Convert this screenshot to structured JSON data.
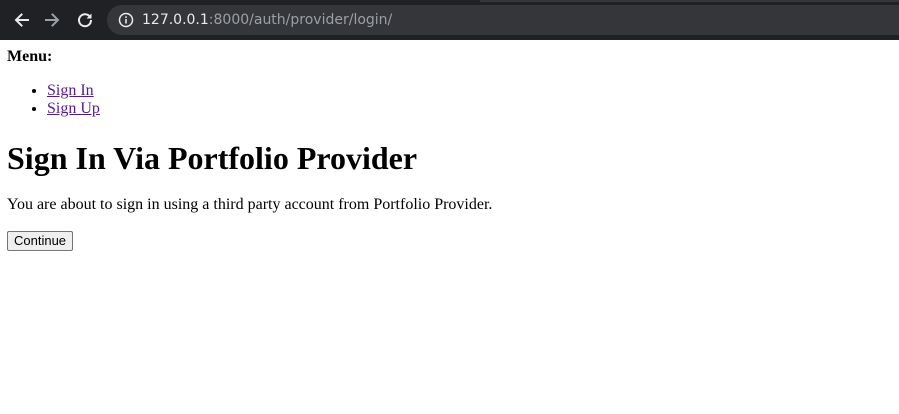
{
  "browser": {
    "url_host": "127.0.0.1",
    "url_path": ":8000/auth/provider/login/",
    "icons": {
      "back": "back-arrow-icon",
      "forward": "forward-arrow-icon",
      "reload": "reload-icon",
      "info": "info-icon"
    }
  },
  "menu": {
    "label": "Menu:",
    "items": [
      {
        "label": "Sign In"
      },
      {
        "label": "Sign Up"
      }
    ]
  },
  "main": {
    "title": "Sign In Via Portfolio Provider",
    "intro": "You are about to sign in using a third party account from Portfolio Provider.",
    "continue_label": "Continue"
  },
  "colors": {
    "toolbar_bg": "#202124",
    "address_bg": "#35363a",
    "visited_link": "#551a8b"
  }
}
